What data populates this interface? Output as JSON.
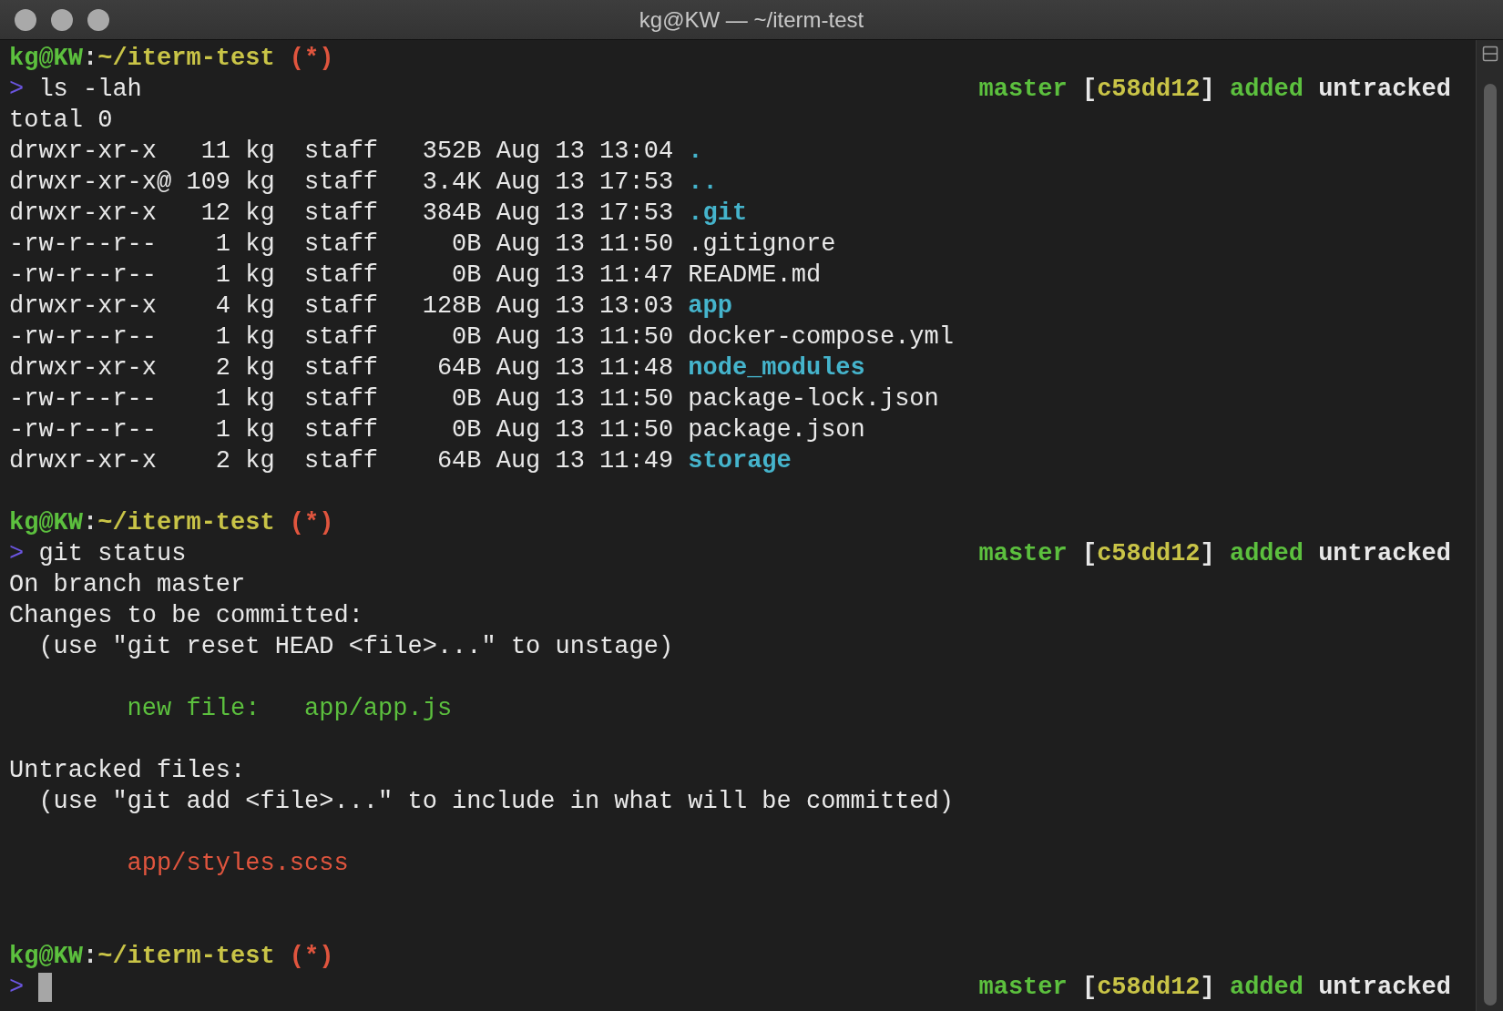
{
  "window": {
    "title": "kg@KW — ~/iterm-test"
  },
  "lines": [
    {
      "kind": "text",
      "segments": [
        {
          "kind": "user",
          "text": "kg@KW"
        },
        {
          "kind": "sep",
          "text": ":"
        },
        {
          "kind": "path",
          "text": "~/iterm-test "
        },
        {
          "kind": "dirty",
          "text": "(*)"
        }
      ]
    },
    {
      "kind": "text",
      "segments": [
        {
          "kind": "arrow",
          "text": ">"
        },
        {
          "kind": "plain",
          "text": " ls -lah"
        }
      ],
      "status": [
        {
          "kind": "branch",
          "text": "master"
        },
        {
          "kind": "bracket",
          "text": " ["
        },
        {
          "kind": "hash",
          "text": "c58dd12"
        },
        {
          "kind": "bracket",
          "text": "]"
        },
        {
          "kind": "added",
          "text": " added"
        },
        {
          "kind": "untracked",
          "text": " untracked"
        }
      ]
    },
    {
      "kind": "text",
      "segments": [
        {
          "kind": "plain",
          "text": "total 0"
        }
      ]
    },
    {
      "kind": "text",
      "segments": [
        {
          "kind": "plain",
          "text": "drwxr-xr-x   11 kg  staff   352B Aug 13 13:04 "
        },
        {
          "kind": "dir",
          "text": "."
        }
      ]
    },
    {
      "kind": "text",
      "segments": [
        {
          "kind": "plain",
          "text": "drwxr-xr-x@ 109 kg  staff   3.4K Aug 13 17:53 "
        },
        {
          "kind": "dir",
          "text": ".."
        }
      ]
    },
    {
      "kind": "text",
      "segments": [
        {
          "kind": "plain",
          "text": "drwxr-xr-x   12 kg  staff   384B Aug 13 17:53 "
        },
        {
          "kind": "dir",
          "text": ".git"
        }
      ]
    },
    {
      "kind": "text",
      "segments": [
        {
          "kind": "plain",
          "text": "-rw-r--r--    1 kg  staff     0B Aug 13 11:50 .gitignore"
        }
      ]
    },
    {
      "kind": "text",
      "segments": [
        {
          "kind": "plain",
          "text": "-rw-r--r--    1 kg  staff     0B Aug 13 11:47 README.md"
        }
      ]
    },
    {
      "kind": "text",
      "segments": [
        {
          "kind": "plain",
          "text": "drwxr-xr-x    4 kg  staff   128B Aug 13 13:03 "
        },
        {
          "kind": "dir",
          "text": "app"
        }
      ]
    },
    {
      "kind": "text",
      "segments": [
        {
          "kind": "plain",
          "text": "-rw-r--r--    1 kg  staff     0B Aug 13 11:50 docker-compose.yml"
        }
      ]
    },
    {
      "kind": "text",
      "segments": [
        {
          "kind": "plain",
          "text": "drwxr-xr-x    2 kg  staff    64B Aug 13 11:48 "
        },
        {
          "kind": "dir",
          "text": "node_modules"
        }
      ]
    },
    {
      "kind": "text",
      "segments": [
        {
          "kind": "plain",
          "text": "-rw-r--r--    1 kg  staff     0B Aug 13 11:50 package-lock.json"
        }
      ]
    },
    {
      "kind": "text",
      "segments": [
        {
          "kind": "plain",
          "text": "-rw-r--r--    1 kg  staff     0B Aug 13 11:50 package.json"
        }
      ]
    },
    {
      "kind": "text",
      "segments": [
        {
          "kind": "plain",
          "text": "drwxr-xr-x    2 kg  staff    64B Aug 13 11:49 "
        },
        {
          "kind": "dir",
          "text": "storage"
        }
      ]
    },
    {
      "kind": "blank"
    },
    {
      "kind": "text",
      "segments": [
        {
          "kind": "user",
          "text": "kg@KW"
        },
        {
          "kind": "sep",
          "text": ":"
        },
        {
          "kind": "path",
          "text": "~/iterm-test "
        },
        {
          "kind": "dirty",
          "text": "(*)"
        }
      ]
    },
    {
      "kind": "text",
      "segments": [
        {
          "kind": "arrow",
          "text": ">"
        },
        {
          "kind": "plain",
          "text": " git status"
        }
      ],
      "status": [
        {
          "kind": "branch",
          "text": "master"
        },
        {
          "kind": "bracket",
          "text": " ["
        },
        {
          "kind": "hash",
          "text": "c58dd12"
        },
        {
          "kind": "bracket",
          "text": "]"
        },
        {
          "kind": "added",
          "text": " added"
        },
        {
          "kind": "untracked",
          "text": " untracked"
        }
      ]
    },
    {
      "kind": "text",
      "segments": [
        {
          "kind": "plain",
          "text": "On branch master"
        }
      ]
    },
    {
      "kind": "text",
      "segments": [
        {
          "kind": "plain",
          "text": "Changes to be committed:"
        }
      ]
    },
    {
      "kind": "text",
      "segments": [
        {
          "kind": "plain",
          "text": "  (use \"git reset HEAD <file>...\" to unstage)"
        }
      ]
    },
    {
      "kind": "blank"
    },
    {
      "kind": "text",
      "segments": [
        {
          "kind": "staged",
          "text": "        new file:   app/app.js"
        }
      ]
    },
    {
      "kind": "blank"
    },
    {
      "kind": "text",
      "segments": [
        {
          "kind": "plain",
          "text": "Untracked files:"
        }
      ]
    },
    {
      "kind": "text",
      "segments": [
        {
          "kind": "plain",
          "text": "  (use \"git add <file>...\" to include in what will be committed)"
        }
      ]
    },
    {
      "kind": "blank"
    },
    {
      "kind": "text",
      "segments": [
        {
          "kind": "unstaged",
          "text": "        app/styles.scss"
        }
      ]
    },
    {
      "kind": "blank"
    },
    {
      "kind": "blank"
    },
    {
      "kind": "text",
      "segments": [
        {
          "kind": "user",
          "text": "kg@KW"
        },
        {
          "kind": "sep",
          "text": ":"
        },
        {
          "kind": "path",
          "text": "~/iterm-test "
        },
        {
          "kind": "dirty",
          "text": "(*)"
        }
      ]
    },
    {
      "kind": "input",
      "segments": [
        {
          "kind": "arrow",
          "text": ">"
        }
      ],
      "status": [
        {
          "kind": "branch",
          "text": "master"
        },
        {
          "kind": "bracket",
          "text": " ["
        },
        {
          "kind": "hash",
          "text": "c58dd12"
        },
        {
          "kind": "bracket",
          "text": "]"
        },
        {
          "kind": "added",
          "text": " added"
        },
        {
          "kind": "untracked",
          "text": " untracked"
        }
      ]
    }
  ]
}
